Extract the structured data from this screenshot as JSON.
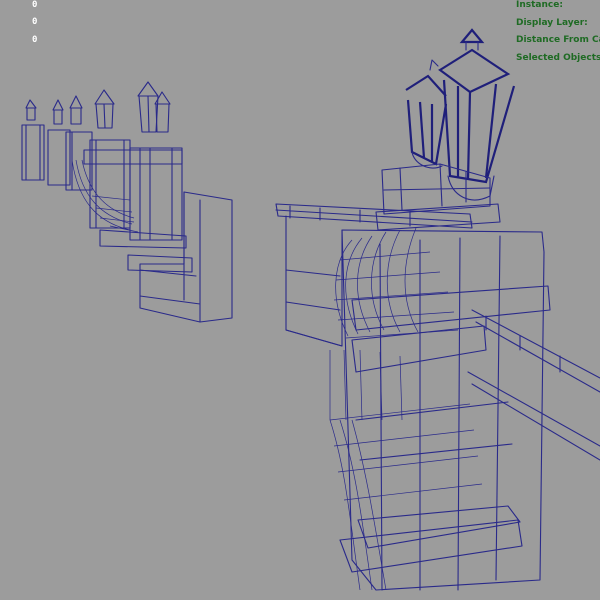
{
  "hud": {
    "counters": [
      "0",
      "0",
      "0"
    ],
    "labels": [
      "Instance:",
      "Display Layer:",
      "Distance From Ca",
      "Selected Objects:"
    ],
    "label_color": "#1f6b24",
    "counter_color": "#ffffff"
  },
  "viewport": {
    "background": "#9c9c9c",
    "wire_color": "#2a2a8a",
    "display_mode": "wireframe"
  }
}
